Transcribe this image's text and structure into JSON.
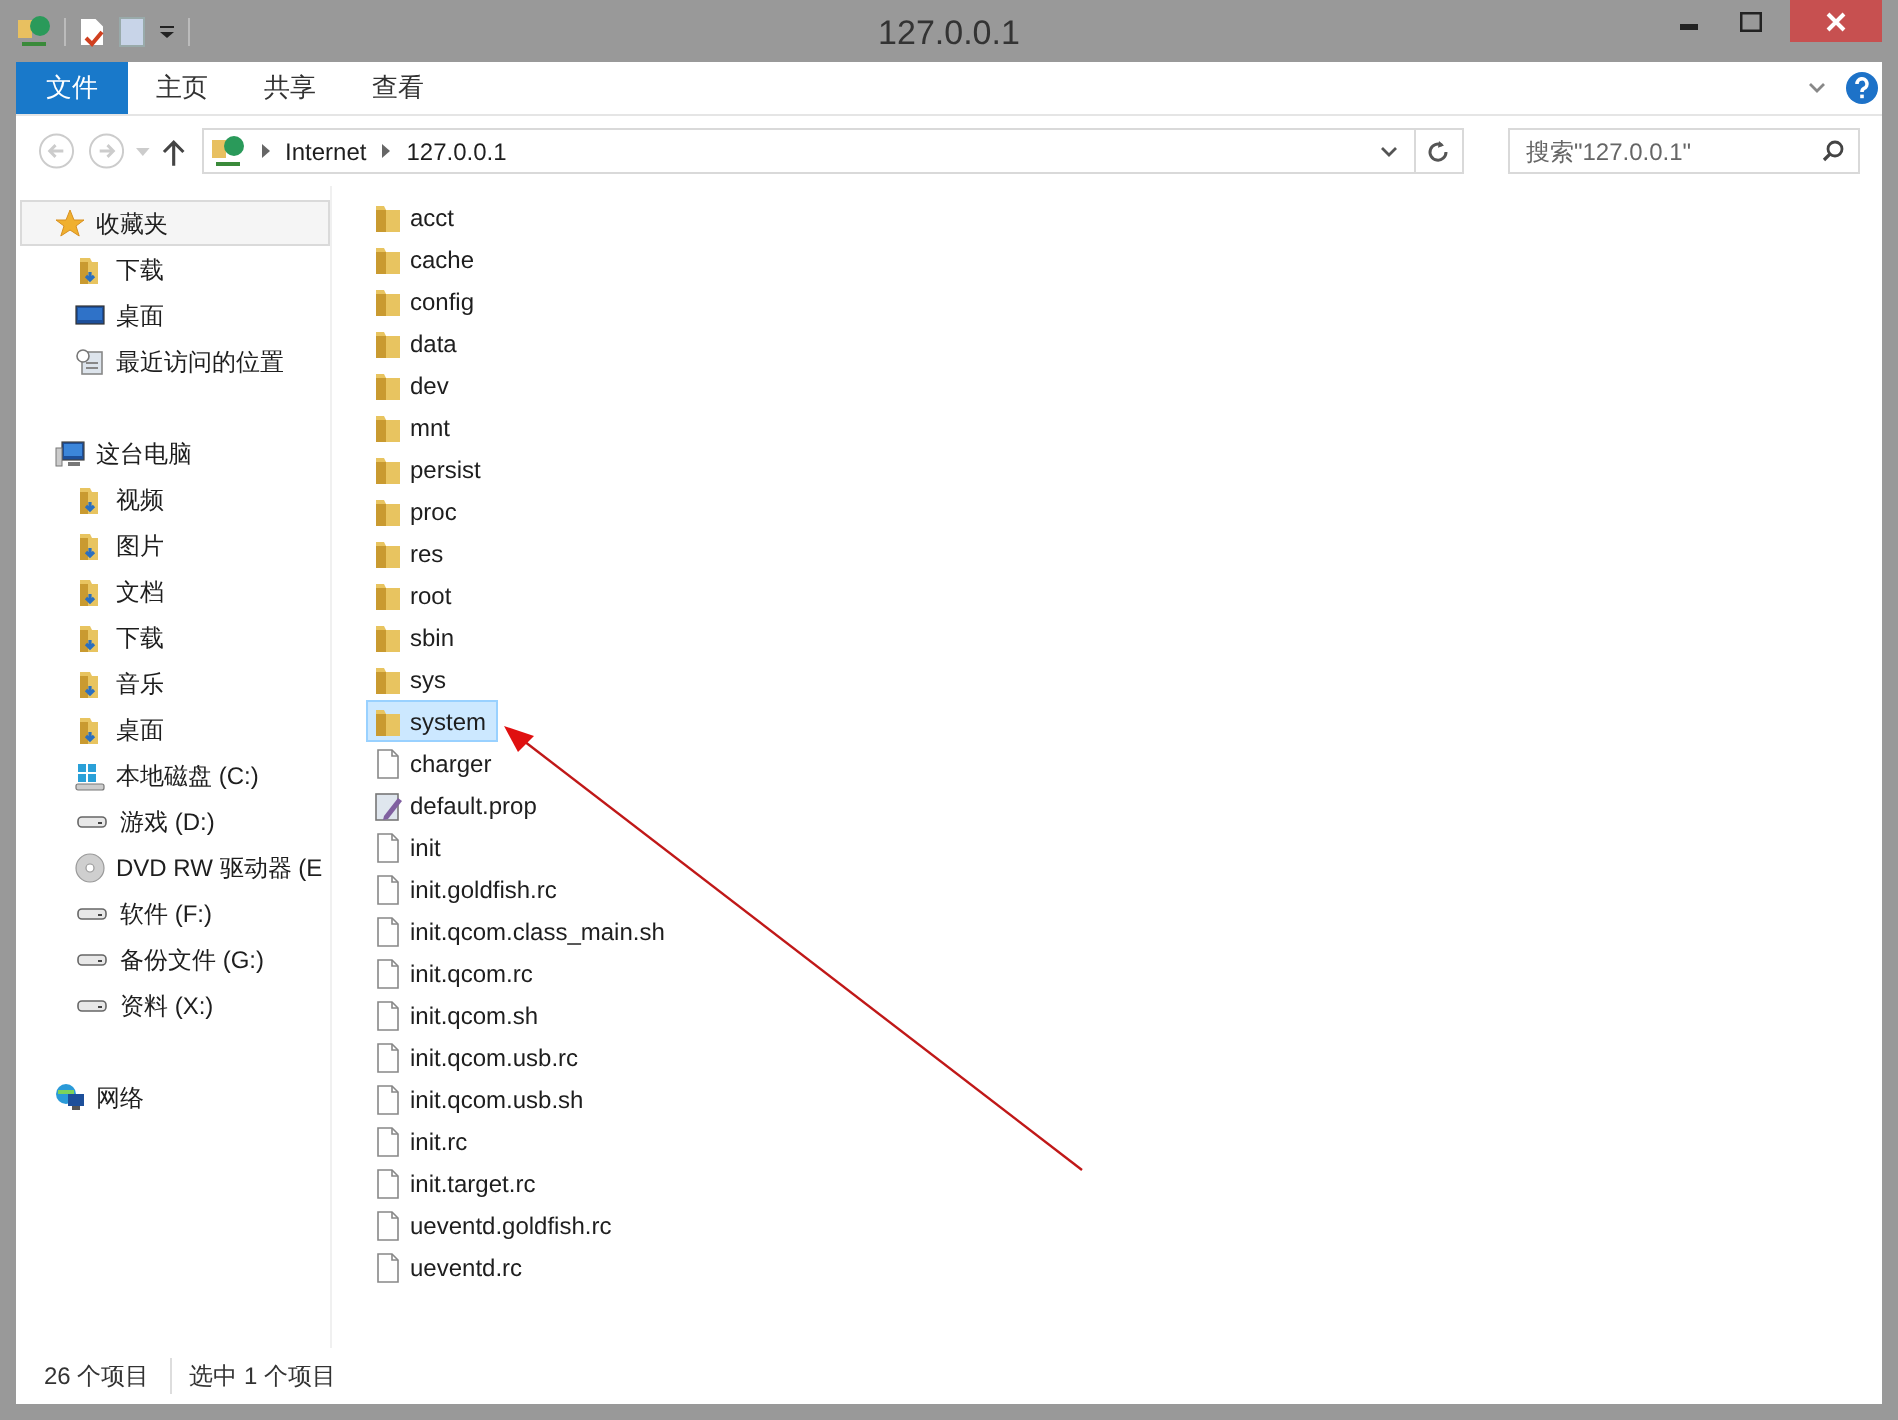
{
  "window": {
    "title": "127.0.0.1"
  },
  "ribbon": {
    "tabs": [
      {
        "label": "文件",
        "selected": true
      },
      {
        "label": "主页",
        "selected": false
      },
      {
        "label": "共享",
        "selected": false
      },
      {
        "label": "查看",
        "selected": false
      }
    ]
  },
  "address_bar": {
    "path": [
      "Internet",
      "127.0.0.1"
    ]
  },
  "search": {
    "placeholder": "搜索\"127.0.0.1\""
  },
  "sidebar": {
    "groups": [
      {
        "label": "收藏夹",
        "kind": "favorites",
        "selected": true,
        "children": [
          {
            "label": "下载",
            "kind": "folder",
            "selected": false
          },
          {
            "label": "桌面",
            "kind": "desktop",
            "selected": false
          },
          {
            "label": "最近访问的位置",
            "kind": "recent",
            "selected": false
          }
        ]
      },
      {
        "label": "这台电脑",
        "kind": "computer",
        "selected": false,
        "children": [
          {
            "label": "视频",
            "kind": "folder",
            "selected": false
          },
          {
            "label": "图片",
            "kind": "folder",
            "selected": false
          },
          {
            "label": "文档",
            "kind": "folder",
            "selected": false
          },
          {
            "label": "下载",
            "kind": "folder",
            "selected": false
          },
          {
            "label": "音乐",
            "kind": "folder",
            "selected": false
          },
          {
            "label": "桌面",
            "kind": "folder",
            "selected": false
          },
          {
            "label": "本地磁盘 (C:)",
            "kind": "system-drive",
            "selected": false
          },
          {
            "label": "游戏 (D:)",
            "kind": "drive",
            "selected": false
          },
          {
            "label": "DVD RW 驱动器 (E",
            "kind": "disc",
            "selected": false
          },
          {
            "label": "软件 (F:)",
            "kind": "drive",
            "selected": false
          },
          {
            "label": "备份文件 (G:)",
            "kind": "drive",
            "selected": false
          },
          {
            "label": "资料 (X:)",
            "kind": "drive",
            "selected": false
          }
        ]
      },
      {
        "label": "网络",
        "kind": "network",
        "selected": false
      }
    ]
  },
  "files": [
    {
      "name": "acct",
      "kind": "folder",
      "selected": false
    },
    {
      "name": "cache",
      "kind": "folder",
      "selected": false
    },
    {
      "name": "config",
      "kind": "folder",
      "selected": false
    },
    {
      "name": "data",
      "kind": "folder",
      "selected": false
    },
    {
      "name": "dev",
      "kind": "folder",
      "selected": false
    },
    {
      "name": "mnt",
      "kind": "folder",
      "selected": false
    },
    {
      "name": "persist",
      "kind": "folder",
      "selected": false
    },
    {
      "name": "proc",
      "kind": "folder",
      "selected": false
    },
    {
      "name": "res",
      "kind": "folder",
      "selected": false
    },
    {
      "name": "root",
      "kind": "folder",
      "selected": false
    },
    {
      "name": "sbin",
      "kind": "folder",
      "selected": false
    },
    {
      "name": "sys",
      "kind": "folder",
      "selected": false
    },
    {
      "name": "system",
      "kind": "folder",
      "selected": true
    },
    {
      "name": "charger",
      "kind": "file",
      "selected": false
    },
    {
      "name": "default.prop",
      "kind": "text",
      "selected": false
    },
    {
      "name": "init",
      "kind": "file",
      "selected": false
    },
    {
      "name": "init.goldfish.rc",
      "kind": "file",
      "selected": false
    },
    {
      "name": "init.qcom.class_main.sh",
      "kind": "file",
      "selected": false
    },
    {
      "name": "init.qcom.rc",
      "kind": "file",
      "selected": false
    },
    {
      "name": "init.qcom.sh",
      "kind": "file",
      "selected": false
    },
    {
      "name": "init.qcom.usb.rc",
      "kind": "file",
      "selected": false
    },
    {
      "name": "init.qcom.usb.sh",
      "kind": "file",
      "selected": false
    },
    {
      "name": "init.rc",
      "kind": "file",
      "selected": false
    },
    {
      "name": "init.target.rc",
      "kind": "file",
      "selected": false
    },
    {
      "name": "ueventd.goldfish.rc",
      "kind": "file",
      "selected": false
    },
    {
      "name": "ueventd.rc",
      "kind": "file",
      "selected": false
    }
  ],
  "status_bar": {
    "item_count": "26 个项目",
    "selection": "选中 1 个项目"
  }
}
